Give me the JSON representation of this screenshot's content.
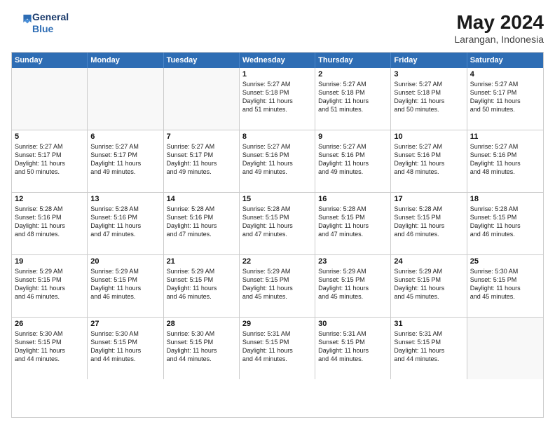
{
  "header": {
    "logo_line1": "General",
    "logo_line2": "Blue",
    "title": "May 2024",
    "subtitle": "Larangan, Indonesia"
  },
  "days_of_week": [
    "Sunday",
    "Monday",
    "Tuesday",
    "Wednesday",
    "Thursday",
    "Friday",
    "Saturday"
  ],
  "weeks": [
    [
      {
        "day": "",
        "info": ""
      },
      {
        "day": "",
        "info": ""
      },
      {
        "day": "",
        "info": ""
      },
      {
        "day": "1",
        "info": "Sunrise: 5:27 AM\nSunset: 5:18 PM\nDaylight: 11 hours\nand 51 minutes."
      },
      {
        "day": "2",
        "info": "Sunrise: 5:27 AM\nSunset: 5:18 PM\nDaylight: 11 hours\nand 51 minutes."
      },
      {
        "day": "3",
        "info": "Sunrise: 5:27 AM\nSunset: 5:18 PM\nDaylight: 11 hours\nand 50 minutes."
      },
      {
        "day": "4",
        "info": "Sunrise: 5:27 AM\nSunset: 5:17 PM\nDaylight: 11 hours\nand 50 minutes."
      }
    ],
    [
      {
        "day": "5",
        "info": "Sunrise: 5:27 AM\nSunset: 5:17 PM\nDaylight: 11 hours\nand 50 minutes."
      },
      {
        "day": "6",
        "info": "Sunrise: 5:27 AM\nSunset: 5:17 PM\nDaylight: 11 hours\nand 49 minutes."
      },
      {
        "day": "7",
        "info": "Sunrise: 5:27 AM\nSunset: 5:17 PM\nDaylight: 11 hours\nand 49 minutes."
      },
      {
        "day": "8",
        "info": "Sunrise: 5:27 AM\nSunset: 5:16 PM\nDaylight: 11 hours\nand 49 minutes."
      },
      {
        "day": "9",
        "info": "Sunrise: 5:27 AM\nSunset: 5:16 PM\nDaylight: 11 hours\nand 49 minutes."
      },
      {
        "day": "10",
        "info": "Sunrise: 5:27 AM\nSunset: 5:16 PM\nDaylight: 11 hours\nand 48 minutes."
      },
      {
        "day": "11",
        "info": "Sunrise: 5:27 AM\nSunset: 5:16 PM\nDaylight: 11 hours\nand 48 minutes."
      }
    ],
    [
      {
        "day": "12",
        "info": "Sunrise: 5:28 AM\nSunset: 5:16 PM\nDaylight: 11 hours\nand 48 minutes."
      },
      {
        "day": "13",
        "info": "Sunrise: 5:28 AM\nSunset: 5:16 PM\nDaylight: 11 hours\nand 47 minutes."
      },
      {
        "day": "14",
        "info": "Sunrise: 5:28 AM\nSunset: 5:16 PM\nDaylight: 11 hours\nand 47 minutes."
      },
      {
        "day": "15",
        "info": "Sunrise: 5:28 AM\nSunset: 5:15 PM\nDaylight: 11 hours\nand 47 minutes."
      },
      {
        "day": "16",
        "info": "Sunrise: 5:28 AM\nSunset: 5:15 PM\nDaylight: 11 hours\nand 47 minutes."
      },
      {
        "day": "17",
        "info": "Sunrise: 5:28 AM\nSunset: 5:15 PM\nDaylight: 11 hours\nand 46 minutes."
      },
      {
        "day": "18",
        "info": "Sunrise: 5:28 AM\nSunset: 5:15 PM\nDaylight: 11 hours\nand 46 minutes."
      }
    ],
    [
      {
        "day": "19",
        "info": "Sunrise: 5:29 AM\nSunset: 5:15 PM\nDaylight: 11 hours\nand 46 minutes."
      },
      {
        "day": "20",
        "info": "Sunrise: 5:29 AM\nSunset: 5:15 PM\nDaylight: 11 hours\nand 46 minutes."
      },
      {
        "day": "21",
        "info": "Sunrise: 5:29 AM\nSunset: 5:15 PM\nDaylight: 11 hours\nand 46 minutes."
      },
      {
        "day": "22",
        "info": "Sunrise: 5:29 AM\nSunset: 5:15 PM\nDaylight: 11 hours\nand 45 minutes."
      },
      {
        "day": "23",
        "info": "Sunrise: 5:29 AM\nSunset: 5:15 PM\nDaylight: 11 hours\nand 45 minutes."
      },
      {
        "day": "24",
        "info": "Sunrise: 5:29 AM\nSunset: 5:15 PM\nDaylight: 11 hours\nand 45 minutes."
      },
      {
        "day": "25",
        "info": "Sunrise: 5:30 AM\nSunset: 5:15 PM\nDaylight: 11 hours\nand 45 minutes."
      }
    ],
    [
      {
        "day": "26",
        "info": "Sunrise: 5:30 AM\nSunset: 5:15 PM\nDaylight: 11 hours\nand 44 minutes."
      },
      {
        "day": "27",
        "info": "Sunrise: 5:30 AM\nSunset: 5:15 PM\nDaylight: 11 hours\nand 44 minutes."
      },
      {
        "day": "28",
        "info": "Sunrise: 5:30 AM\nSunset: 5:15 PM\nDaylight: 11 hours\nand 44 minutes."
      },
      {
        "day": "29",
        "info": "Sunrise: 5:31 AM\nSunset: 5:15 PM\nDaylight: 11 hours\nand 44 minutes."
      },
      {
        "day": "30",
        "info": "Sunrise: 5:31 AM\nSunset: 5:15 PM\nDaylight: 11 hours\nand 44 minutes."
      },
      {
        "day": "31",
        "info": "Sunrise: 5:31 AM\nSunset: 5:15 PM\nDaylight: 11 hours\nand 44 minutes."
      },
      {
        "day": "",
        "info": ""
      }
    ]
  ]
}
